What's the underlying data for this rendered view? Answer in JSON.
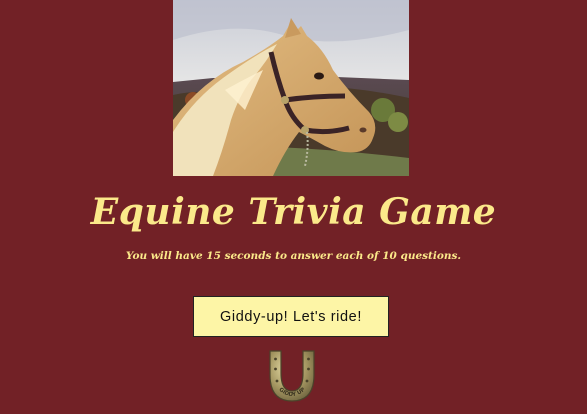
{
  "photo": {
    "subject": "palomino horse head with halter"
  },
  "title": "Equine Trivia Game",
  "subtitle": "You will have 15 seconds to answer each of 10 questions.",
  "start_button_label": "Giddy-up! Let's ride!",
  "horseshoe_text": "GIDDY UP",
  "colors": {
    "background": "#722126",
    "text_accent": "#fbe98a",
    "button_bg": "#fdf5a6"
  }
}
